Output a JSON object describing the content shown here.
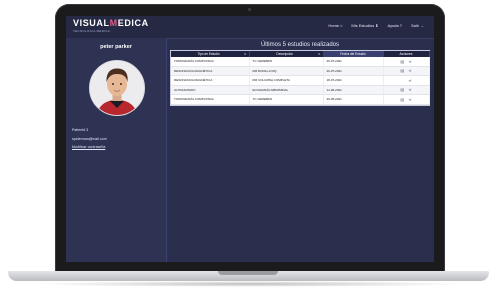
{
  "app": {
    "logo_text_before": "VISUAL",
    "logo_text_m": "M",
    "logo_text_after": "EDICA",
    "logo_subtitle": "TECNOLOGIA MEDICA"
  },
  "nav": {
    "items": [
      {
        "label": "Home",
        "icon": "home-icon"
      },
      {
        "label": "Mis Estudios",
        "icon": "download-icon"
      },
      {
        "label": "Ayuda",
        "icon": "help-icon"
      },
      {
        "label": "Salir",
        "icon": "logout-icon"
      }
    ]
  },
  "profile": {
    "name": "peter parker",
    "patient_id": "Patient# 3",
    "email": "spiderman@mail.com",
    "edit_password": "Modificar contraseña"
  },
  "studies": {
    "title": "Últimos 5 estudios realizados",
    "columns": [
      "Tipo de Estudio",
      "Descripción",
      "Fecha del Estudio",
      "Acciones"
    ],
    "rows": [
      {
        "type": "TOMOGRAFÍA COMPUTADA",
        "description": "TC CEREBRO",
        "date": "20-07-2021",
        "has_download": true
      },
      {
        "type": "RESONANCIA MAGNÉTICA",
        "description": "RM RODILLA IZQ",
        "date": "20-07-2021",
        "has_download": true
      },
      {
        "type": "RESONANCIA MAGNÉTICA",
        "description": "RM COLUMNA COMPLETA",
        "date": "18-07-2021",
        "has_download": false
      },
      {
        "type": "ULTRASONIDO",
        "description": "ECOGRAFÍA ABDOMINAL",
        "date": "14-06-2021",
        "has_download": true
      },
      {
        "type": "TOMOGRAFÍA COMPUTADA",
        "description": "TC CEREBRO",
        "date": "26-05-2021",
        "has_download": true
      }
    ]
  },
  "colors": {
    "background": "#2b2f4e",
    "header": "#1f2340",
    "accent": "#e05d8a"
  }
}
